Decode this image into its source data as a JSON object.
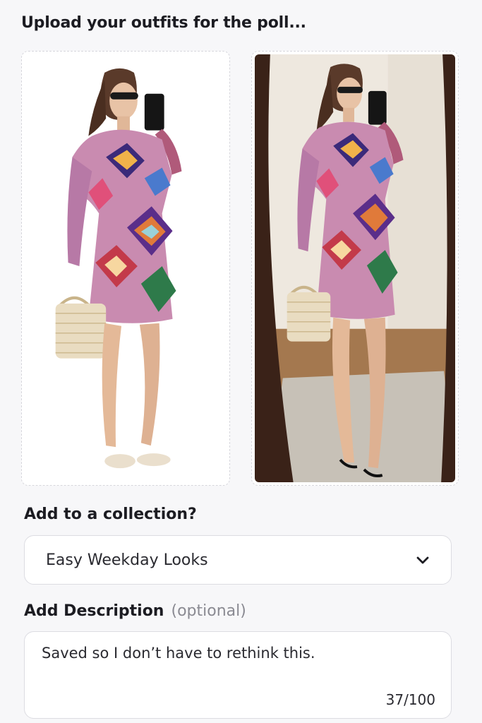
{
  "page": {
    "heading": "Upload your outfits for the poll..."
  },
  "uploads": [
    {
      "alt": "Outfit photo 1 - patterned wrap dress on white background"
    },
    {
      "alt": "Outfit photo 2 - mirror selfie in patterned wrap dress"
    }
  ],
  "collection": {
    "label": "Add to a collection?",
    "selected": "Easy Weekday Looks",
    "icon": "chevron-down-icon"
  },
  "description": {
    "label": "Add Description",
    "optional_label": "(optional)",
    "value": "Saved so I don’t have to rethink this.",
    "counter": "37/100"
  },
  "colors": {
    "background": "#f7f7f9",
    "border": "#dcdce2",
    "text": "#1c1c22",
    "muted": "#8a8a92"
  }
}
